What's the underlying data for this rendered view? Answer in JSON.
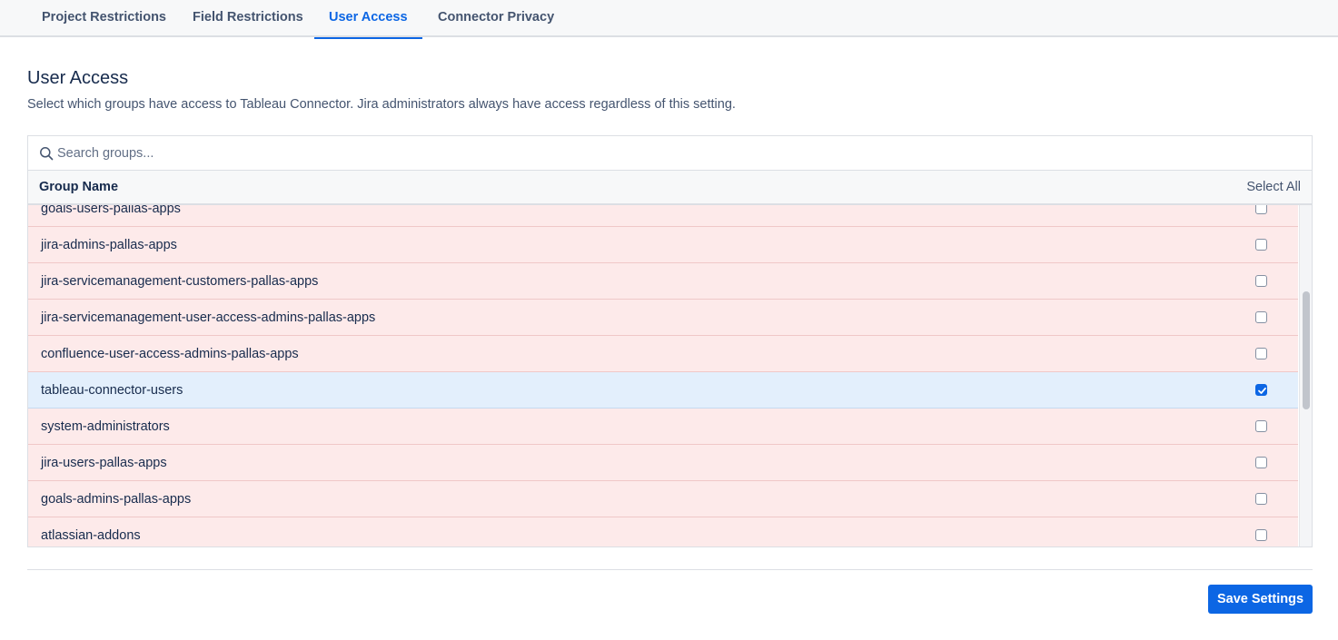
{
  "tabs": [
    {
      "label": "Project Restrictions",
      "active": false
    },
    {
      "label": "Field Restrictions",
      "active": false
    },
    {
      "label": "User Access",
      "active": true
    },
    {
      "label": "Connector Privacy",
      "active": false
    }
  ],
  "section": {
    "title": "User Access",
    "description": "Select which groups have access to Tableau Connector. Jira administrators always have access regardless of this setting."
  },
  "search": {
    "placeholder": "Search groups...",
    "value": "",
    "icon": "search-icon"
  },
  "table": {
    "header_name": "Group Name",
    "header_select": "Select All",
    "rows": [
      {
        "name": "goals-users-pallas-apps",
        "checked": false
      },
      {
        "name": "jira-admins-pallas-apps",
        "checked": false
      },
      {
        "name": "jira-servicemanagement-customers-pallas-apps",
        "checked": false
      },
      {
        "name": "jira-servicemanagement-user-access-admins-pallas-apps",
        "checked": false
      },
      {
        "name": "confluence-user-access-admins-pallas-apps",
        "checked": false
      },
      {
        "name": "tableau-connector-users",
        "checked": true
      },
      {
        "name": "system-administrators",
        "checked": false
      },
      {
        "name": "jira-users-pallas-apps",
        "checked": false
      },
      {
        "name": "goals-admins-pallas-apps",
        "checked": false
      },
      {
        "name": "atlassian-addons",
        "checked": false
      }
    ]
  },
  "footer": {
    "save_label": "Save Settings"
  },
  "colors": {
    "accent": "#0c66e4",
    "denied_row": "#fdeaea",
    "granted_row": "#e3effc"
  }
}
